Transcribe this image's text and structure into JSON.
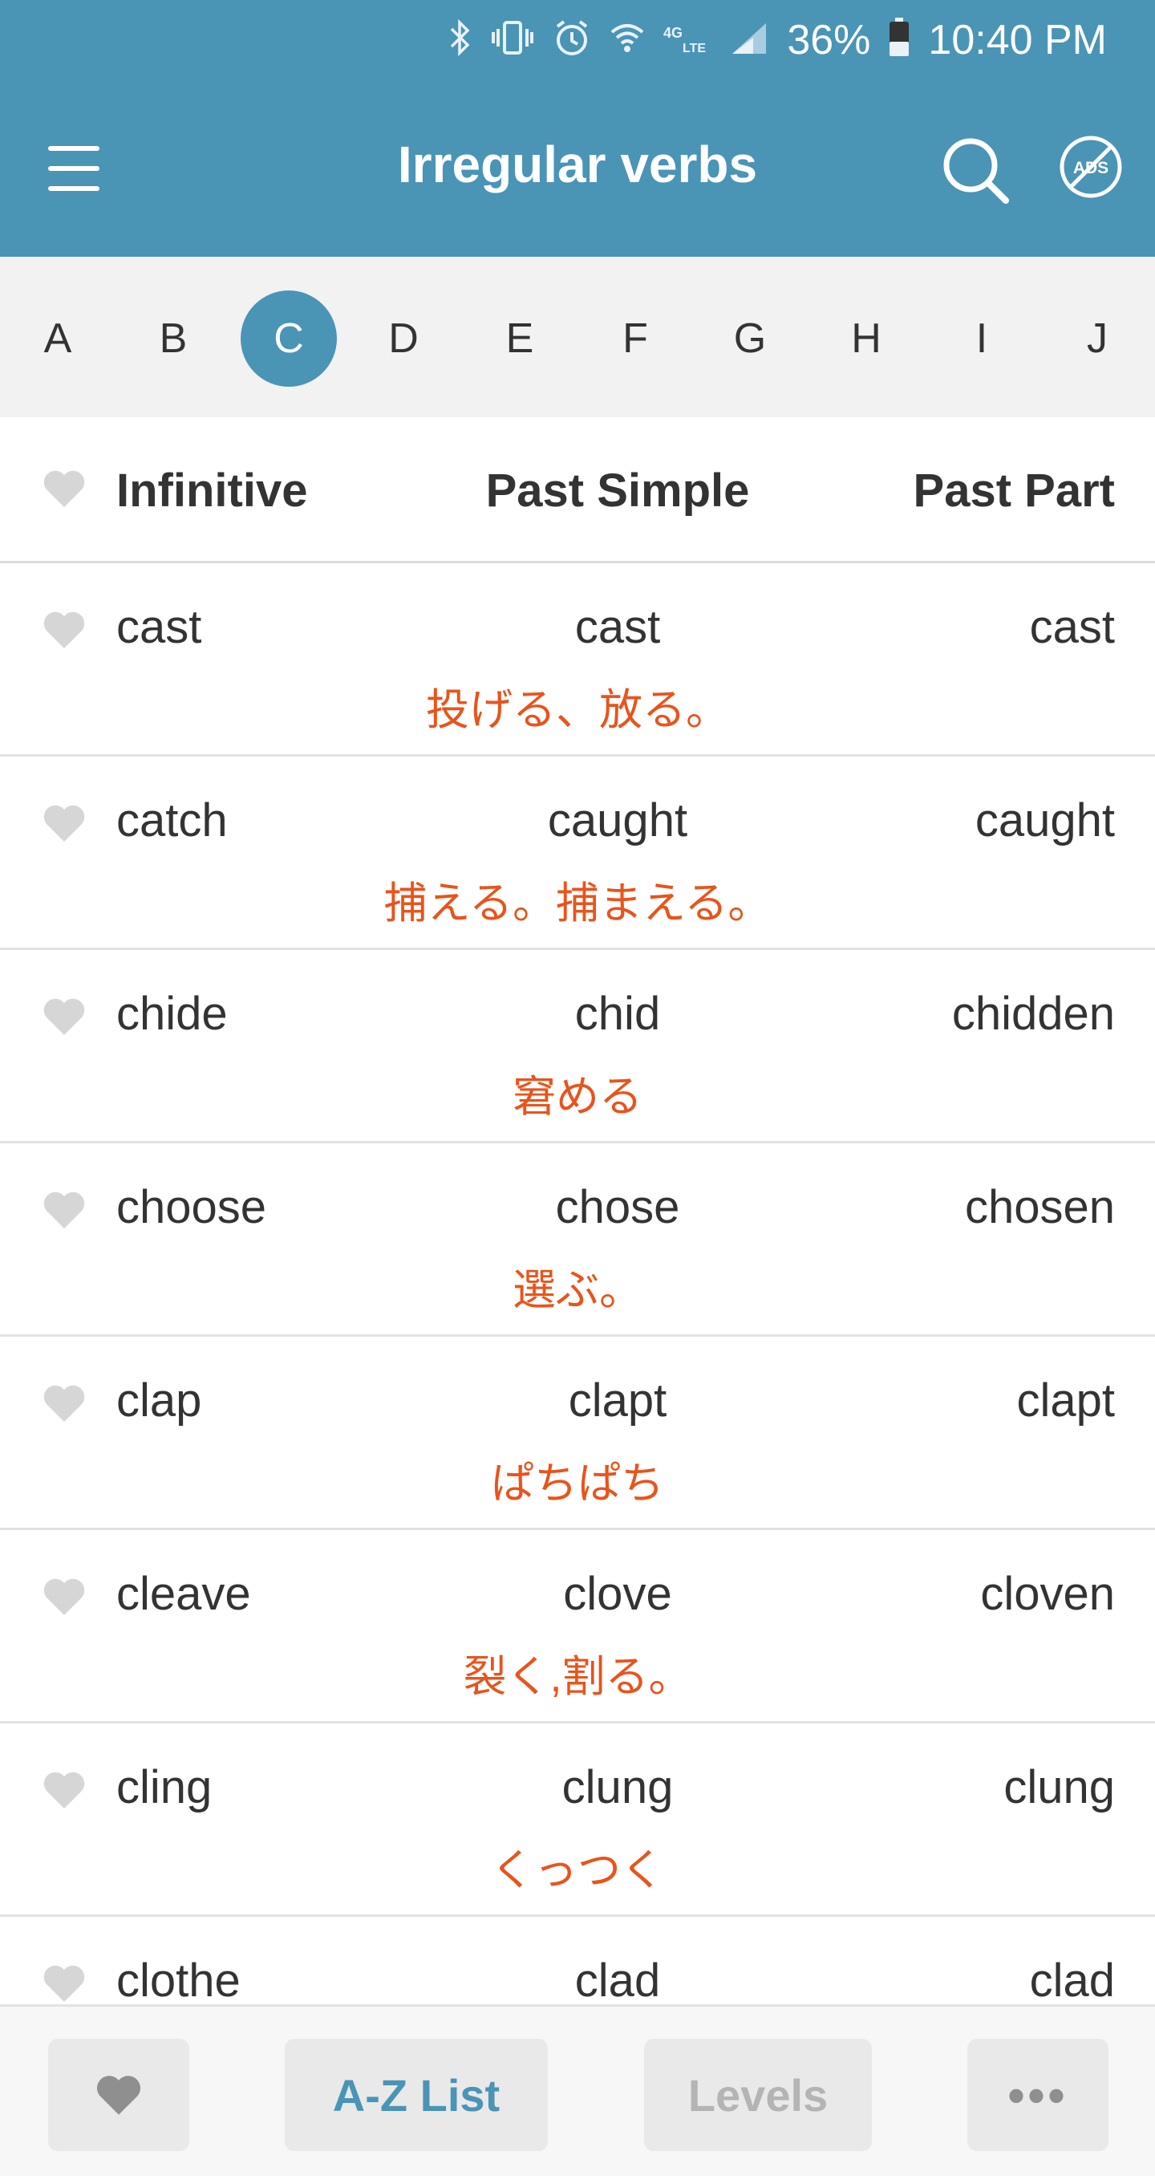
{
  "status_bar": {
    "battery": "36%",
    "time": "10:40 PM",
    "icons": [
      "bluetooth-icon",
      "vibrate-icon",
      "alarm-icon",
      "wifi-icon",
      "lte-icon",
      "signal-icon",
      "battery-icon"
    ]
  },
  "app_bar": {
    "title": "Irregular verbs",
    "icons": [
      "menu-icon",
      "search-icon",
      "no-ads-icon"
    ]
  },
  "letters": [
    "A",
    "B",
    "C",
    "D",
    "E",
    "F",
    "G",
    "H",
    "I",
    "J"
  ],
  "active_letter": "C",
  "table": {
    "headers": {
      "infinitive": "Infinitive",
      "past_simple": "Past Simple",
      "past_participle": "Past Part"
    },
    "rows": [
      {
        "infinitive": "cast",
        "past_simple": "cast",
        "past_participle": "cast",
        "translation": "投げる、放る。"
      },
      {
        "infinitive": "catch",
        "past_simple": "caught",
        "past_participle": "caught",
        "translation": "捕える。捕まえる。"
      },
      {
        "infinitive": "chide",
        "past_simple": "chid",
        "past_participle": "chidden",
        "translation": "窘める"
      },
      {
        "infinitive": "choose",
        "past_simple": "chose",
        "past_participle": "chosen",
        "translation": "選ぶ。"
      },
      {
        "infinitive": "clap",
        "past_simple": "clapt",
        "past_participle": "clapt",
        "translation": "ぱちぱち"
      },
      {
        "infinitive": "cleave",
        "past_simple": "clove",
        "past_participle": "cloven",
        "translation": "裂く,割る。"
      },
      {
        "infinitive": "cling",
        "past_simple": "clung",
        "past_participle": "clung",
        "translation": "くっつく"
      },
      {
        "infinitive": "clothe",
        "past_simple": "clad",
        "past_participle": "clad",
        "translation": ""
      }
    ]
  },
  "bottom_bar": {
    "favorites_icon": "heart-icon",
    "az_label": "A-Z List",
    "levels_label": "Levels",
    "more_label": "•••"
  },
  "colors": {
    "primary": "#4a94b6",
    "translation": "#e8541c",
    "heart": "#d6d6d6"
  }
}
